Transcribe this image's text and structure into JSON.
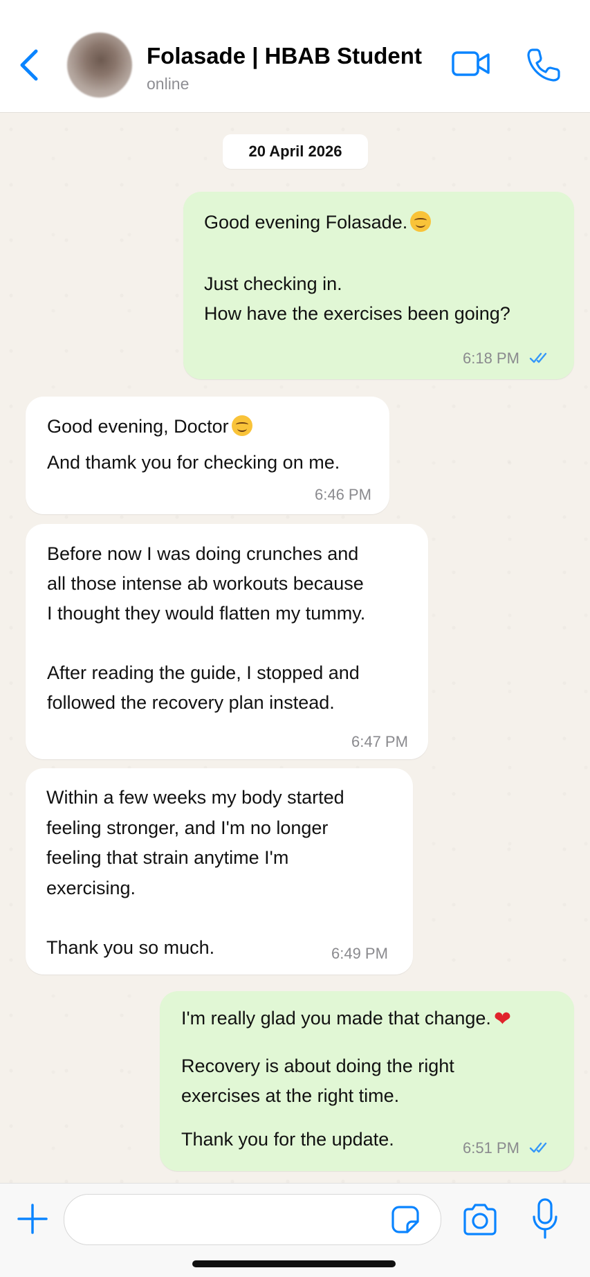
{
  "header": {
    "contact_name": "Folasade | HBAB Student",
    "status": "online",
    "icons": [
      "chevron-left-icon",
      "avatar",
      "video-call-icon",
      "phone-call-icon"
    ],
    "accent_color": "#0a84ff"
  },
  "chat": {
    "date_label": "20 April 2026",
    "messages": [
      {
        "direction": "outgoing",
        "lines": [
          "Good evening Folasade.",
          "Just checking in.",
          "How have the exercises been going?"
        ],
        "emoji": "smiling-face",
        "time": "6:18 PM",
        "read": true
      },
      {
        "direction": "incoming",
        "lines": [
          "Good evening, Doctor",
          "And thamk you for checking on me."
        ],
        "emoji": "smiling-face",
        "time": "6:46 PM"
      },
      {
        "direction": "incoming",
        "lines": [
          "Before now I was doing crunches and",
          "all those intense ab workouts because",
          "I thought they would flatten my tummy.",
          "After reading the guide, I stopped and",
          "followed the recovery plan instead."
        ],
        "time": "6:47 PM"
      },
      {
        "direction": "incoming",
        "lines": [
          "Within a few weeks my body started",
          "feeling stronger, and I'm no longer",
          "feeling that strain anytime I'm",
          "exercising.",
          "Thank you so much."
        ],
        "time": "6:49 PM"
      },
      {
        "direction": "outgoing",
        "lines": [
          "I'm really glad you made that change.",
          "Recovery is about doing the right",
          "exercises at the right time.",
          "Thank you for the update."
        ],
        "emoji": "red-heart",
        "time": "6:51 PM",
        "read": true
      }
    ]
  },
  "composer": {
    "input_value": "",
    "icons": [
      "plus-icon",
      "sticker-icon",
      "camera-icon",
      "microphone-icon"
    ]
  },
  "colors": {
    "outgoing_bubble": "#e1f7d5",
    "incoming_bubble": "#ffffff",
    "chat_background": "#f5f1eb",
    "read_ticks": "#3497f9"
  }
}
